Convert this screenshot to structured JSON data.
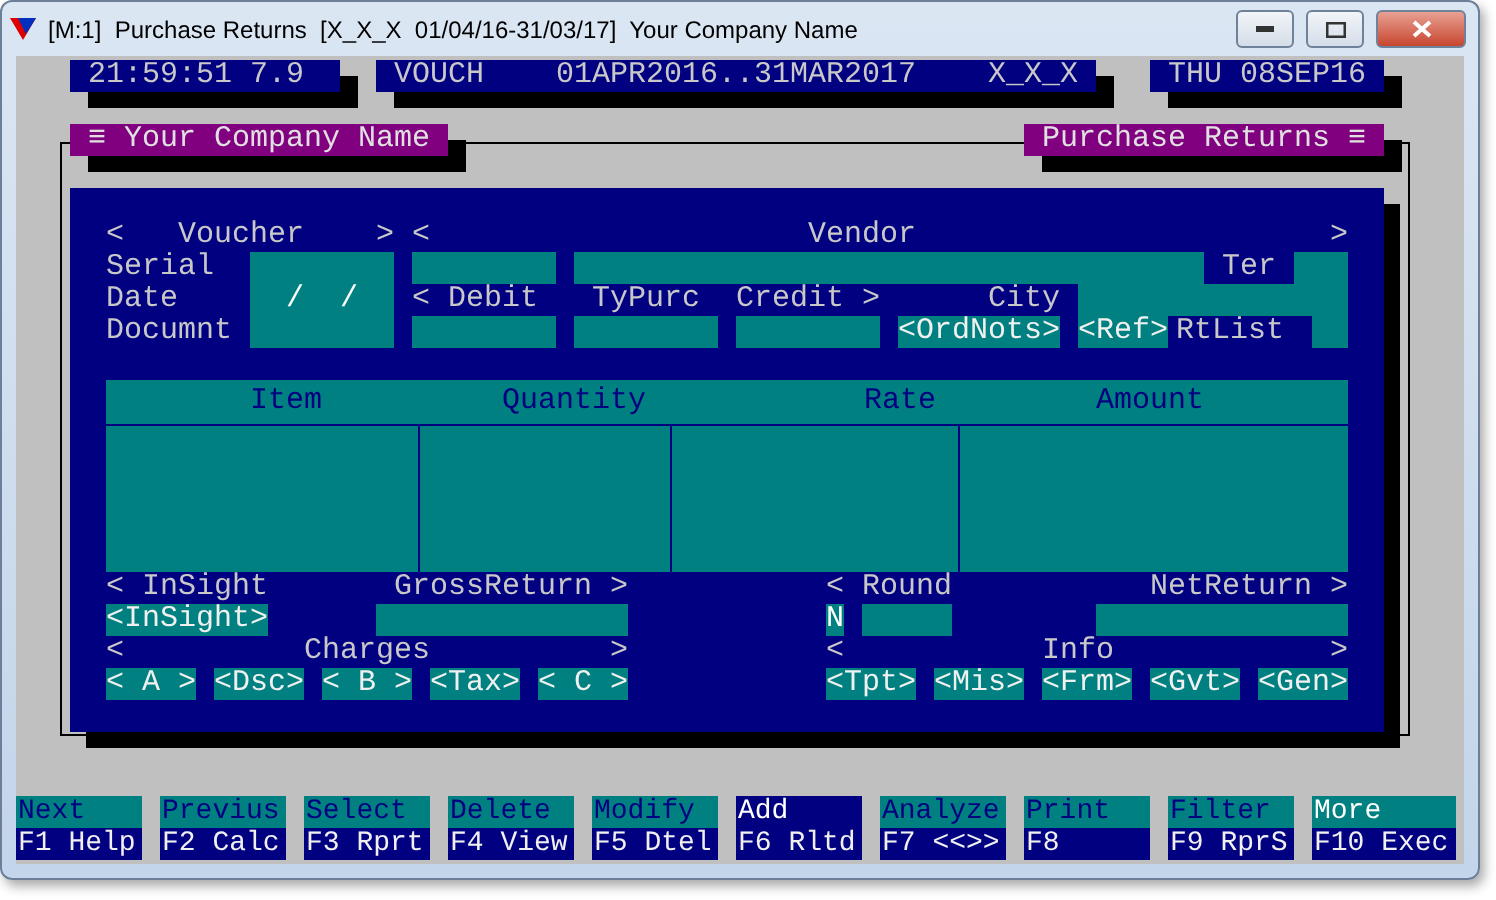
{
  "window": {
    "title": "[M:1]  Purchase Returns  [X_X_X  01/04/16-31/03/17]  Your Company Name"
  },
  "status": {
    "clock": "21:59:51 7.9",
    "mode": "VOUCH",
    "period": "01APR2016..31MAR2017",
    "user": "X_X_X",
    "date": "THU 08SEP16"
  },
  "tabs": {
    "company": "≡ Your Company Name",
    "module": "Purchase Returns ≡"
  },
  "voucher": {
    "open": "<",
    "title": "Voucher",
    "close": ">",
    "labels": [
      "Serial",
      "Date",
      "Documnt"
    ],
    "date_value": "/  /"
  },
  "vendor": {
    "open": "<",
    "title": "Vendor",
    "close": ">",
    "ter": "Ter",
    "debit": "< Debit",
    "typurc": "TyPurc",
    "credit": "Credit >",
    "city": "City",
    "ordnots": "<OrdNots>",
    "ref": "<Ref>",
    "rtlist": "RtList"
  },
  "table": {
    "columns": [
      "Item",
      "Quantity",
      "Rate",
      "Amount"
    ]
  },
  "totals": {
    "insight_label": "< InSight",
    "gross_label": "GrossReturn >",
    "round_label": "< Round",
    "net_label": "NetReturn >",
    "insight_button": "<InSight>",
    "round_flag": "N"
  },
  "charges": {
    "open": "<",
    "title": "Charges",
    "close": ">",
    "buttons": [
      "< A >",
      "<Dsc>",
      "< B >",
      "<Tax>",
      "< C >"
    ]
  },
  "info": {
    "open": "<",
    "title": "Info",
    "close": ">",
    "buttons": [
      "<Tpt>",
      "<Mis>",
      "<Frm>",
      "<Gvt>",
      "<Gen>"
    ]
  },
  "function_keys": [
    {
      "action": "Next",
      "key": "F1 Help",
      "selected": false,
      "highlighted": false
    },
    {
      "action": "Previus",
      "key": "F2 Calc",
      "selected": false,
      "highlighted": false
    },
    {
      "action": "Select",
      "key": "F3 Rprt",
      "selected": false,
      "highlighted": false
    },
    {
      "action": "Delete",
      "key": "F4 View",
      "selected": false,
      "highlighted": false
    },
    {
      "action": "Modify",
      "key": "F5 Dtel",
      "selected": false,
      "highlighted": false
    },
    {
      "action": "Add",
      "key": "F6 Rltd",
      "selected": true,
      "highlighted": false
    },
    {
      "action": "Analyze",
      "key": "F7 <<>>",
      "selected": false,
      "highlighted": false
    },
    {
      "action": "Print",
      "key": "F8",
      "selected": false,
      "highlighted": false
    },
    {
      "action": "Filter",
      "key": "F9 RprS",
      "selected": false,
      "highlighted": false
    },
    {
      "action": "More",
      "key": "F10 Exec",
      "selected": false,
      "highlighted": true
    }
  ]
}
